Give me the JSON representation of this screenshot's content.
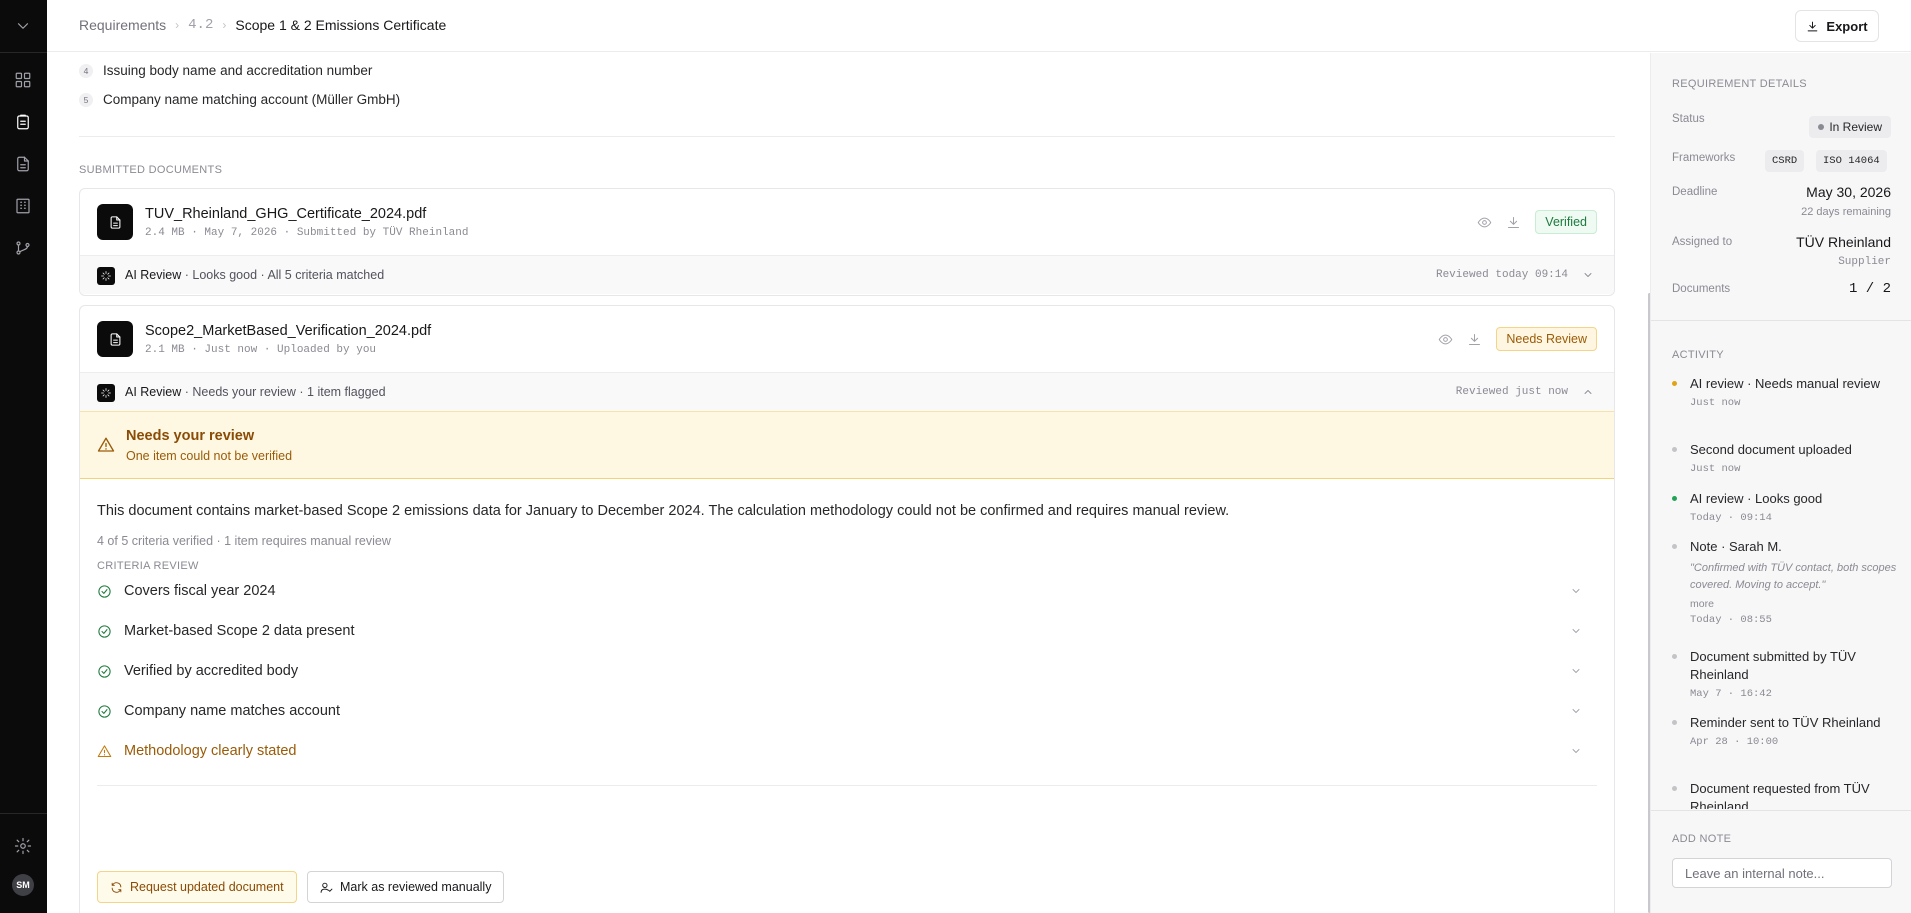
{
  "breadcrumb": {
    "root": "Requirements",
    "section": "4.2",
    "current": "Scope 1 & 2 Emissions Certificate"
  },
  "toolbar": {
    "export_label": "Export"
  },
  "user": {
    "initials": "SM"
  },
  "required_items": [
    {
      "num": "4",
      "text": "Issuing body name and accreditation number"
    },
    {
      "num": "5",
      "text": "Company name matching account (Müller GmbH)"
    }
  ],
  "submitted_title": "SUBMITTED DOCUMENTS",
  "documents": [
    {
      "name": "TUV_Rheinland_GHG_Certificate_2024.pdf",
      "meta": "2.4 MB · May 7, 2026 · Submitted by TÜV Rheinland",
      "badge": "Verified",
      "ai_label": "AI Review",
      "ai_summary": " · Looks good · All 5 criteria matched",
      "ai_reviewed": "Reviewed today 09:14"
    },
    {
      "name": "Scope2_MarketBased_Verification_2024.pdf",
      "meta": "2.1 MB · Just now · Uploaded by you",
      "badge": "Needs Review",
      "ai_label": "AI Review",
      "ai_summary": " · Needs your review · 1 item flagged",
      "ai_reviewed": "Reviewed just now"
    }
  ],
  "alert": {
    "title": "Needs your review",
    "subtitle": "One item could not be verified"
  },
  "summary": "This document contains market-based Scope 2 emissions data for January to December 2024. The calculation methodology could not be confirmed and requires manual review.",
  "criteria_count": "4 of 5 criteria verified · 1 item requires manual review",
  "criteria_title": "CRITERIA REVIEW",
  "criteria": [
    {
      "label": "Covers fiscal year 2024",
      "status": "pass"
    },
    {
      "label": "Market-based Scope 2 data present",
      "status": "pass"
    },
    {
      "label": "Verified by accredited body",
      "status": "pass"
    },
    {
      "label": "Company name matches account",
      "status": "pass"
    },
    {
      "label": "Methodology clearly stated",
      "status": "warn"
    }
  ],
  "actions": {
    "request_label": "Request updated document",
    "mark_label": "Mark as reviewed manually"
  },
  "details": {
    "title": "REQUIREMENT DETAILS",
    "status_label": "Status",
    "status_value": "In Review",
    "frameworks_label": "Frameworks",
    "frameworks": [
      "CSRD",
      "ISO 14064"
    ],
    "deadline_label": "Deadline",
    "deadline_value": "May 30, 2026",
    "deadline_remaining": "22 days remaining",
    "assigned_label": "Assigned to",
    "assigned_value": "TÜV Rheinland",
    "assigned_role": "Supplier",
    "documents_label": "Documents",
    "documents_value": "1 / 2"
  },
  "activity": {
    "title": "ACTIVITY",
    "items": [
      {
        "text": "AI review · Needs manual review",
        "time": "Just now"
      },
      {
        "text": "Second document uploaded",
        "time": "Just now"
      },
      {
        "text": "AI review · Looks good",
        "time": "Today · 09:14"
      },
      {
        "text": "Note · Sarah M.",
        "quote": "\"Confirmed with TÜV contact, both scopes covered. Moving to accept.\"",
        "more": "more",
        "time": "Today · 08:55"
      },
      {
        "text": "Document submitted by TÜV Rheinland",
        "time": "May 7 · 16:42"
      },
      {
        "text": "Reminder sent to TÜV Rheinland",
        "time": "Apr 28 · 10:00"
      },
      {
        "text": "Document requested from TÜV Rheinland",
        "time": ""
      }
    ]
  },
  "note": {
    "title": "ADD NOTE",
    "placeholder": "Leave an internal note..."
  },
  "colors": {
    "accent_amber": "#9a5b08",
    "success_green": "#1e7a3e",
    "rail_bg": "#0b0b0c"
  },
  "icons": [
    "chevron-down-icon",
    "dashboard-icon",
    "clipboard-icon",
    "file-icon",
    "building-icon",
    "git-branch-icon",
    "settings-icon",
    "download-icon",
    "eye-icon",
    "sparkle-icon",
    "alert-triangle-icon",
    "check-circle-icon",
    "refresh-icon",
    "user-check-icon"
  ]
}
